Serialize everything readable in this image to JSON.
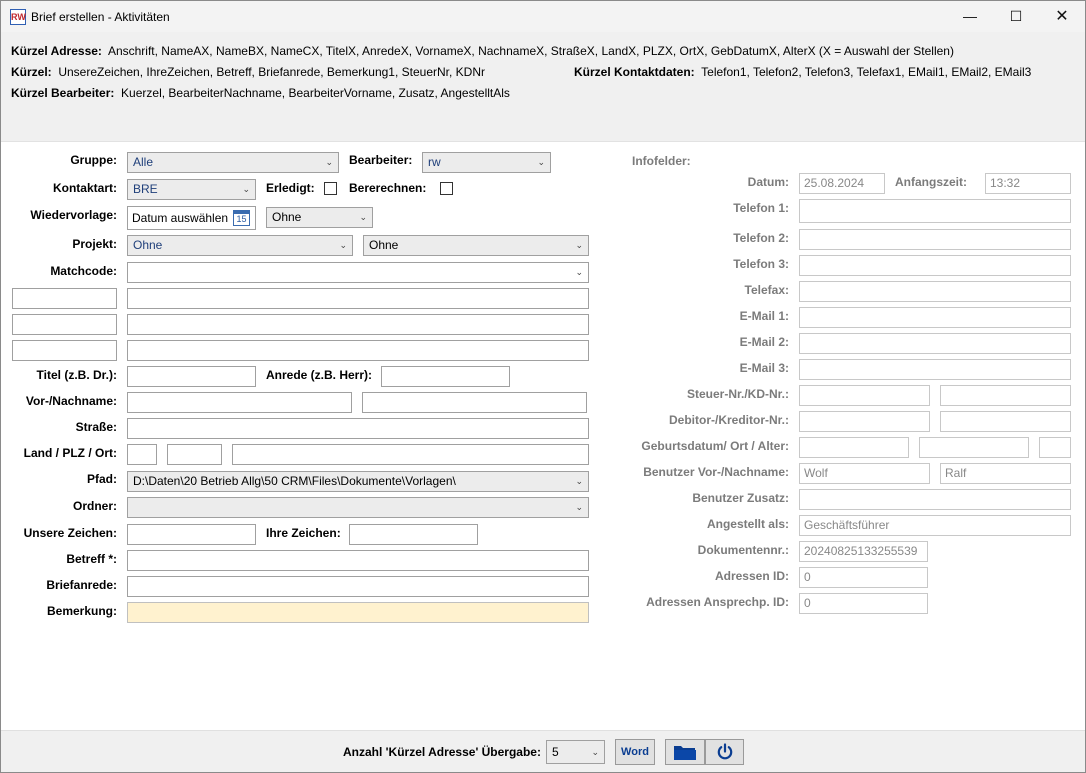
{
  "window": {
    "title": "Brief erstellen - Aktivitäten",
    "app_icon_text": "RW"
  },
  "header": {
    "line1_label": "Kürzel Adresse:",
    "line1_value": "Anschrift, NameAX, NameBX, NameCX, TitelX, AnredeX, VornameX, NachnameX, StraßeX, LandX, PLZX, OrtX, GebDatumX, AlterX (X = Auswahl der Stellen)",
    "line2_label": "Kürzel:",
    "line2_value": "UnsereZeichen, IhreZeichen, Betreff, Briefanrede, Bemerkung1, SteuerNr, KDNr",
    "line2b_label": "Kürzel Kontaktdaten:",
    "line2b_value": "Telefon1, Telefon2, Telefon3, Telefax1, EMail1, EMail2, EMail3",
    "line3_label": "Kürzel Bearbeiter:",
    "line3_value": "Kuerzel, BearbeiterNachname, BearbeiterVorname, Zusatz, AngestelltAls"
  },
  "left": {
    "gruppe_label": "Gruppe:",
    "gruppe_value": "Alle",
    "bearbeiter_label": "Bearbeiter:",
    "bearbeiter_value": "rw",
    "kontaktart_label": "Kontaktart:",
    "kontaktart_value": "BRE",
    "erledigt_label": "Erledigt:",
    "bererechnen_label": "Bererechnen:",
    "wiedervorlage_label": "Wiedervorlage:",
    "wiedervorlage_date": "Datum auswählen",
    "cal_day": "15",
    "wiedervorlage_select": "Ohne",
    "projekt_label": "Projekt:",
    "projekt_value": "Ohne",
    "projekt_value2": "Ohne",
    "matchcode_label": "Matchcode:",
    "titel_label": "Titel (z.B. Dr.):",
    "anrede_label": "Anrede (z.B. Herr):",
    "name_label": "Vor-/Nachname:",
    "strasse_label": "Straße:",
    "land_label": "Land / PLZ / Ort:",
    "pfad_label": "Pfad:",
    "pfad_value": "D:\\Daten\\20 Betrieb Allg\\50 CRM\\Files\\Dokumente\\Vorlagen\\",
    "ordner_label": "Ordner:",
    "unsere_label": "Unsere Zeichen:",
    "ihre_label": "Ihre Zeichen:",
    "betreff_label": "Betreff *:",
    "briefanrede_label": "Briefanrede:",
    "bemerkung_label": "Bemerkung:"
  },
  "right": {
    "infofelder_label": "Infofelder:",
    "datum_label": "Datum:",
    "datum_value": "25.08.2024",
    "anfangszeit_label": "Anfangszeit:",
    "anfangszeit_value": "13:32",
    "telefon1_label": "Telefon 1:",
    "telefon2_label": "Telefon 2:",
    "telefon3_label": "Telefon 3:",
    "telefax_label": "Telefax:",
    "email1_label": "E-Mail 1:",
    "email2_label": "E-Mail 2:",
    "email3_label": "E-Mail 3:",
    "steuer_label": "Steuer-Nr./KD-Nr.:",
    "debitor_label": "Debitor-/Kreditor-Nr.:",
    "geburt_label": "Geburtsdatum/ Ort / Alter:",
    "benutzer_name_label": "Benutzer Vor-/Nachname:",
    "benutzer_vorname": "Wolf",
    "benutzer_nachname": "Ralf",
    "benutzer_zusatz_label": "Benutzer Zusatz:",
    "angestellt_label": "Angestellt als:",
    "angestellt_value": "Geschäftsführer",
    "dokumentennr_label": "Dokumentennr.:",
    "dokumentennr_value": "20240825133255539",
    "adressen_id_label": "Adressen ID:",
    "adressen_id_value": "0",
    "ansprech_id_label": "Adressen Ansprechp. ID:",
    "ansprech_id_value": "0"
  },
  "footer": {
    "anzahl_label": "Anzahl 'Kürzel Adresse' Übergabe:",
    "anzahl_value": "5",
    "word_label": "Word"
  },
  "colors": {
    "accent_blue": "#0a3d91",
    "bemerkung_bg": "#fff2cf"
  }
}
